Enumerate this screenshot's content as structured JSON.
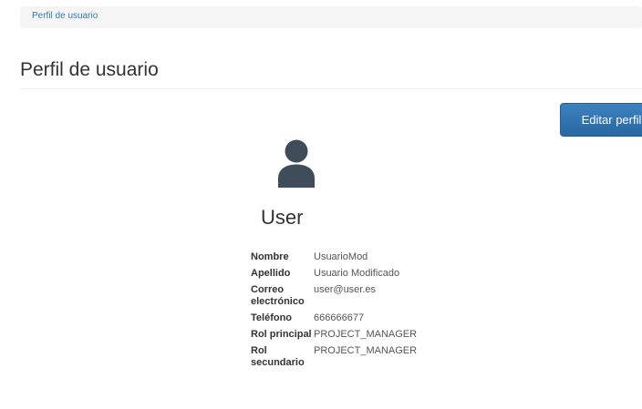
{
  "breadcrumb": {
    "items": [
      "Perfil de usuario"
    ]
  },
  "header": {
    "title": "Perfil de usuario"
  },
  "actions": {
    "edit_label": "Editar perfil"
  },
  "profile": {
    "avatar_icon": "user-silhouette-icon",
    "name": "User",
    "fields": [
      {
        "label": "Nombre",
        "value": "UsuarioMod"
      },
      {
        "label": "Apellido",
        "value": "Usuario Modificado"
      },
      {
        "label": "Correo electrónico",
        "value": "user@user.es"
      },
      {
        "label": "Teléfono",
        "value": "666666677"
      },
      {
        "label": "Rol principal",
        "value": "PROJECT_MANAGER"
      },
      {
        "label": "Rol secundario",
        "value": "PROJECT_MANAGER"
      }
    ]
  },
  "colors": {
    "link": "#337ab7",
    "primary_button": "#2f6fa7",
    "avatar": "#3f4d5b"
  }
}
